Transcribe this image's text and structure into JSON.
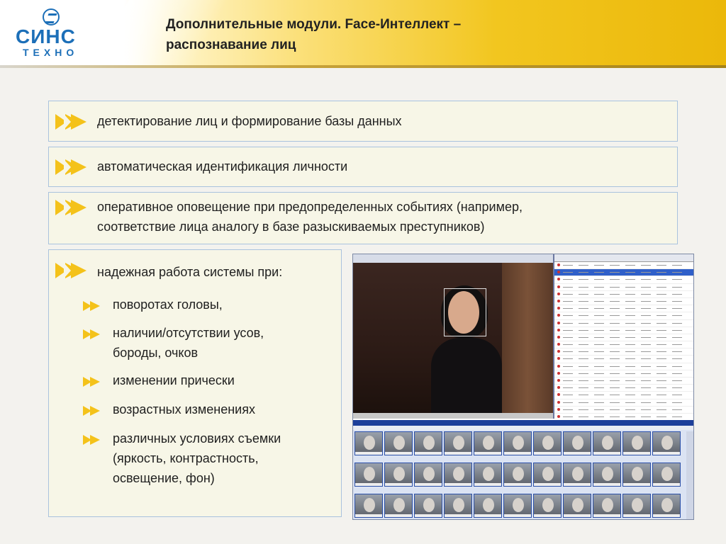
{
  "header": {
    "logo_word": "СИНС",
    "logo_sub": "ТЕХНО",
    "title_line1": "Дополнительные модули. Face-Интеллект –",
    "title_line2": "распознавание лиц"
  },
  "boxes": [
    {
      "text": "детектирование лиц и формирование базы данных"
    },
    {
      "text": "автоматическая идентификация личности"
    },
    {
      "line1": "оперативное оповещение при предопределенных событиях (например,",
      "line2": "соответствие лица аналогу в базе разыскиваемых преступников)"
    }
  ],
  "reliability": {
    "heading": "надежная работа системы при:",
    "items": [
      {
        "lines": [
          "поворотах головы,"
        ]
      },
      {
        "lines": [
          "наличии/отсутствии усов,",
          "бороды, очков"
        ]
      },
      {
        "lines": [
          "изменении прически"
        ]
      },
      {
        "lines": [
          "возрастных изменениях"
        ]
      },
      {
        "lines": [
          "различных условиях съемки",
          "(яркость, контрастность,",
          "освещение, фон)"
        ]
      }
    ]
  },
  "colors": {
    "accent": "#f4c21a",
    "box_bg": "#f7f6e7",
    "box_border": "#a9c2de",
    "logo": "#1c6fb8"
  },
  "icons": [
    "chevron-bullet-icon",
    "logo-mark-icon"
  ]
}
